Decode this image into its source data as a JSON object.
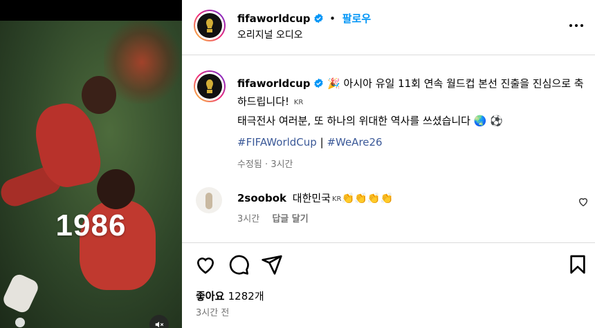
{
  "media": {
    "year_text": "1986"
  },
  "header": {
    "username": "fifaworldcup",
    "separator": "•",
    "follow_label": "팔로우",
    "audio_label": "오리지널 오디오"
  },
  "caption": {
    "username": "fifaworldcup",
    "emoji_party": "🎉",
    "line1": "아시아 유일 11회 연속 월드컵 본선 진출을 진심으로 축하드립니다!",
    "flag1": "KR",
    "line2": "태극전사 여러분, 또 하나의 위대한 역사를 쓰셨습니다",
    "emoji_globe": "🌏",
    "emoji_ball": "⚽",
    "hashtag1": "#FIFAWorldCup",
    "hashtag_sep": "|",
    "hashtag2": "#WeAre26",
    "edited_label": "수정됨",
    "edited_sep": "·",
    "edited_time": "3시간"
  },
  "comment": {
    "username": "2soobok",
    "text": "대한민국",
    "flag": "KR",
    "emojis": "👏👏👏👏",
    "time": "3시간",
    "reply_label": "답글 달기"
  },
  "actions": {
    "likes_label": "좋아요",
    "likes_count": "1282개",
    "post_time": "3시간 전"
  },
  "colors": {
    "follow_blue": "#0095f6",
    "hashtag_blue": "#3b5998",
    "verified_blue": "#0095f6",
    "muted_grey": "#737373"
  },
  "icons": {
    "verified": "verified-badge-icon",
    "more": "more-options-icon",
    "heart": "heart-icon",
    "comment": "comment-icon",
    "share": "share-icon",
    "save": "bookmark-icon",
    "mute": "mute-icon"
  }
}
